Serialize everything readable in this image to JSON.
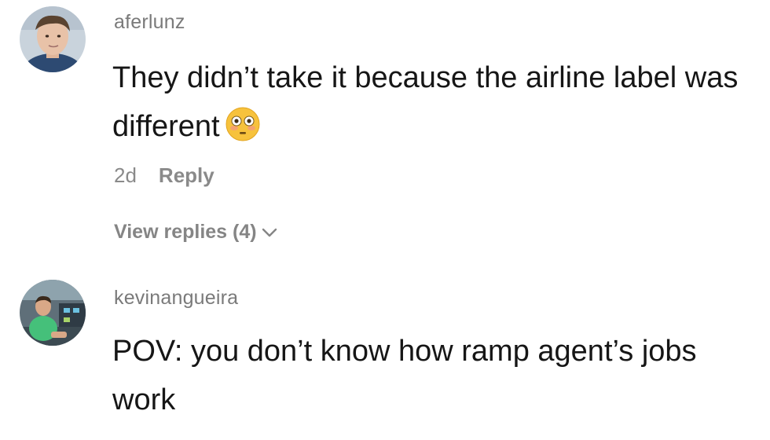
{
  "comments": [
    {
      "username": "aferlunz",
      "text": "They didn’t take it because the airline label was different",
      "emoji_icon": "flushed-face-emoji",
      "timestamp": "2d",
      "reply_label": "Reply",
      "view_replies_label": "View replies (4)"
    },
    {
      "username": "kevinangueira",
      "text": "POV: you don’t know how ramp agent’s jobs work"
    }
  ],
  "colors": {
    "username": "#7a7a7a",
    "text": "#161616",
    "meta": "#8a8a8a",
    "emoji": "#f7c23c"
  }
}
